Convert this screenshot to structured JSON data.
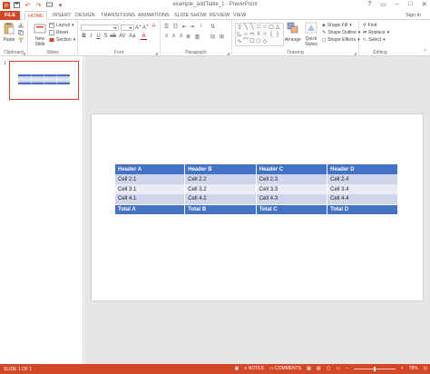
{
  "window": {
    "title": "example_addTable_1 - PowerPoint",
    "signin_label": "Sign in"
  },
  "tabs": [
    "FILE",
    "HOME",
    "INSERT",
    "DESIGN",
    "TRANSITIONS",
    "ANIMATIONS",
    "SLIDE SHOW",
    "REVIEW",
    "VIEW"
  ],
  "ribbon": {
    "clipboard": {
      "label": "Clipboard",
      "paste": "Paste"
    },
    "slides": {
      "label": "Slides",
      "new_slide": "New Slide",
      "layout": "Layout",
      "reset": "Reset",
      "section": "Section"
    },
    "font": {
      "label": "Font"
    },
    "paragraph": {
      "label": "Paragraph"
    },
    "drawing": {
      "label": "Drawing",
      "arrange": "Arrange",
      "quick_styles": "Quick Styles",
      "shape_fill": "Shape Fill",
      "shape_outline": "Shape Outline",
      "shape_effects": "Shape Effects"
    },
    "editing": {
      "label": "Editing",
      "find": "Find",
      "replace": "Replace",
      "select": "Select"
    }
  },
  "slides_pane": {
    "slide_number": "1"
  },
  "slide_table": {
    "header": [
      "Header A",
      "Header B",
      "Header C",
      "Header D"
    ],
    "rows": [
      [
        "Cell 2.1",
        "Cell 2.2",
        "Cell 2.3",
        "Cell 2.4"
      ],
      [
        "Cell 3.1",
        "Cell 3.2",
        "Cell 3.3",
        "Cell 3.4"
      ],
      [
        "Cell 4.1",
        "Cell 4.2",
        "Cell 4.3",
        "Cell 4.4"
      ]
    ],
    "total": [
      "Total A",
      "Total B",
      "Total C",
      "Total D"
    ]
  },
  "status": {
    "slide_info": "SLIDE 1 OF 1",
    "notes": "NOTES",
    "comments": "COMMENTS",
    "zoom": "78%"
  },
  "colors": {
    "accent": "#d24726",
    "table_header": "#4472c4",
    "table_band1": "#cfd5ea",
    "table_band2": "#e9ebf5"
  }
}
